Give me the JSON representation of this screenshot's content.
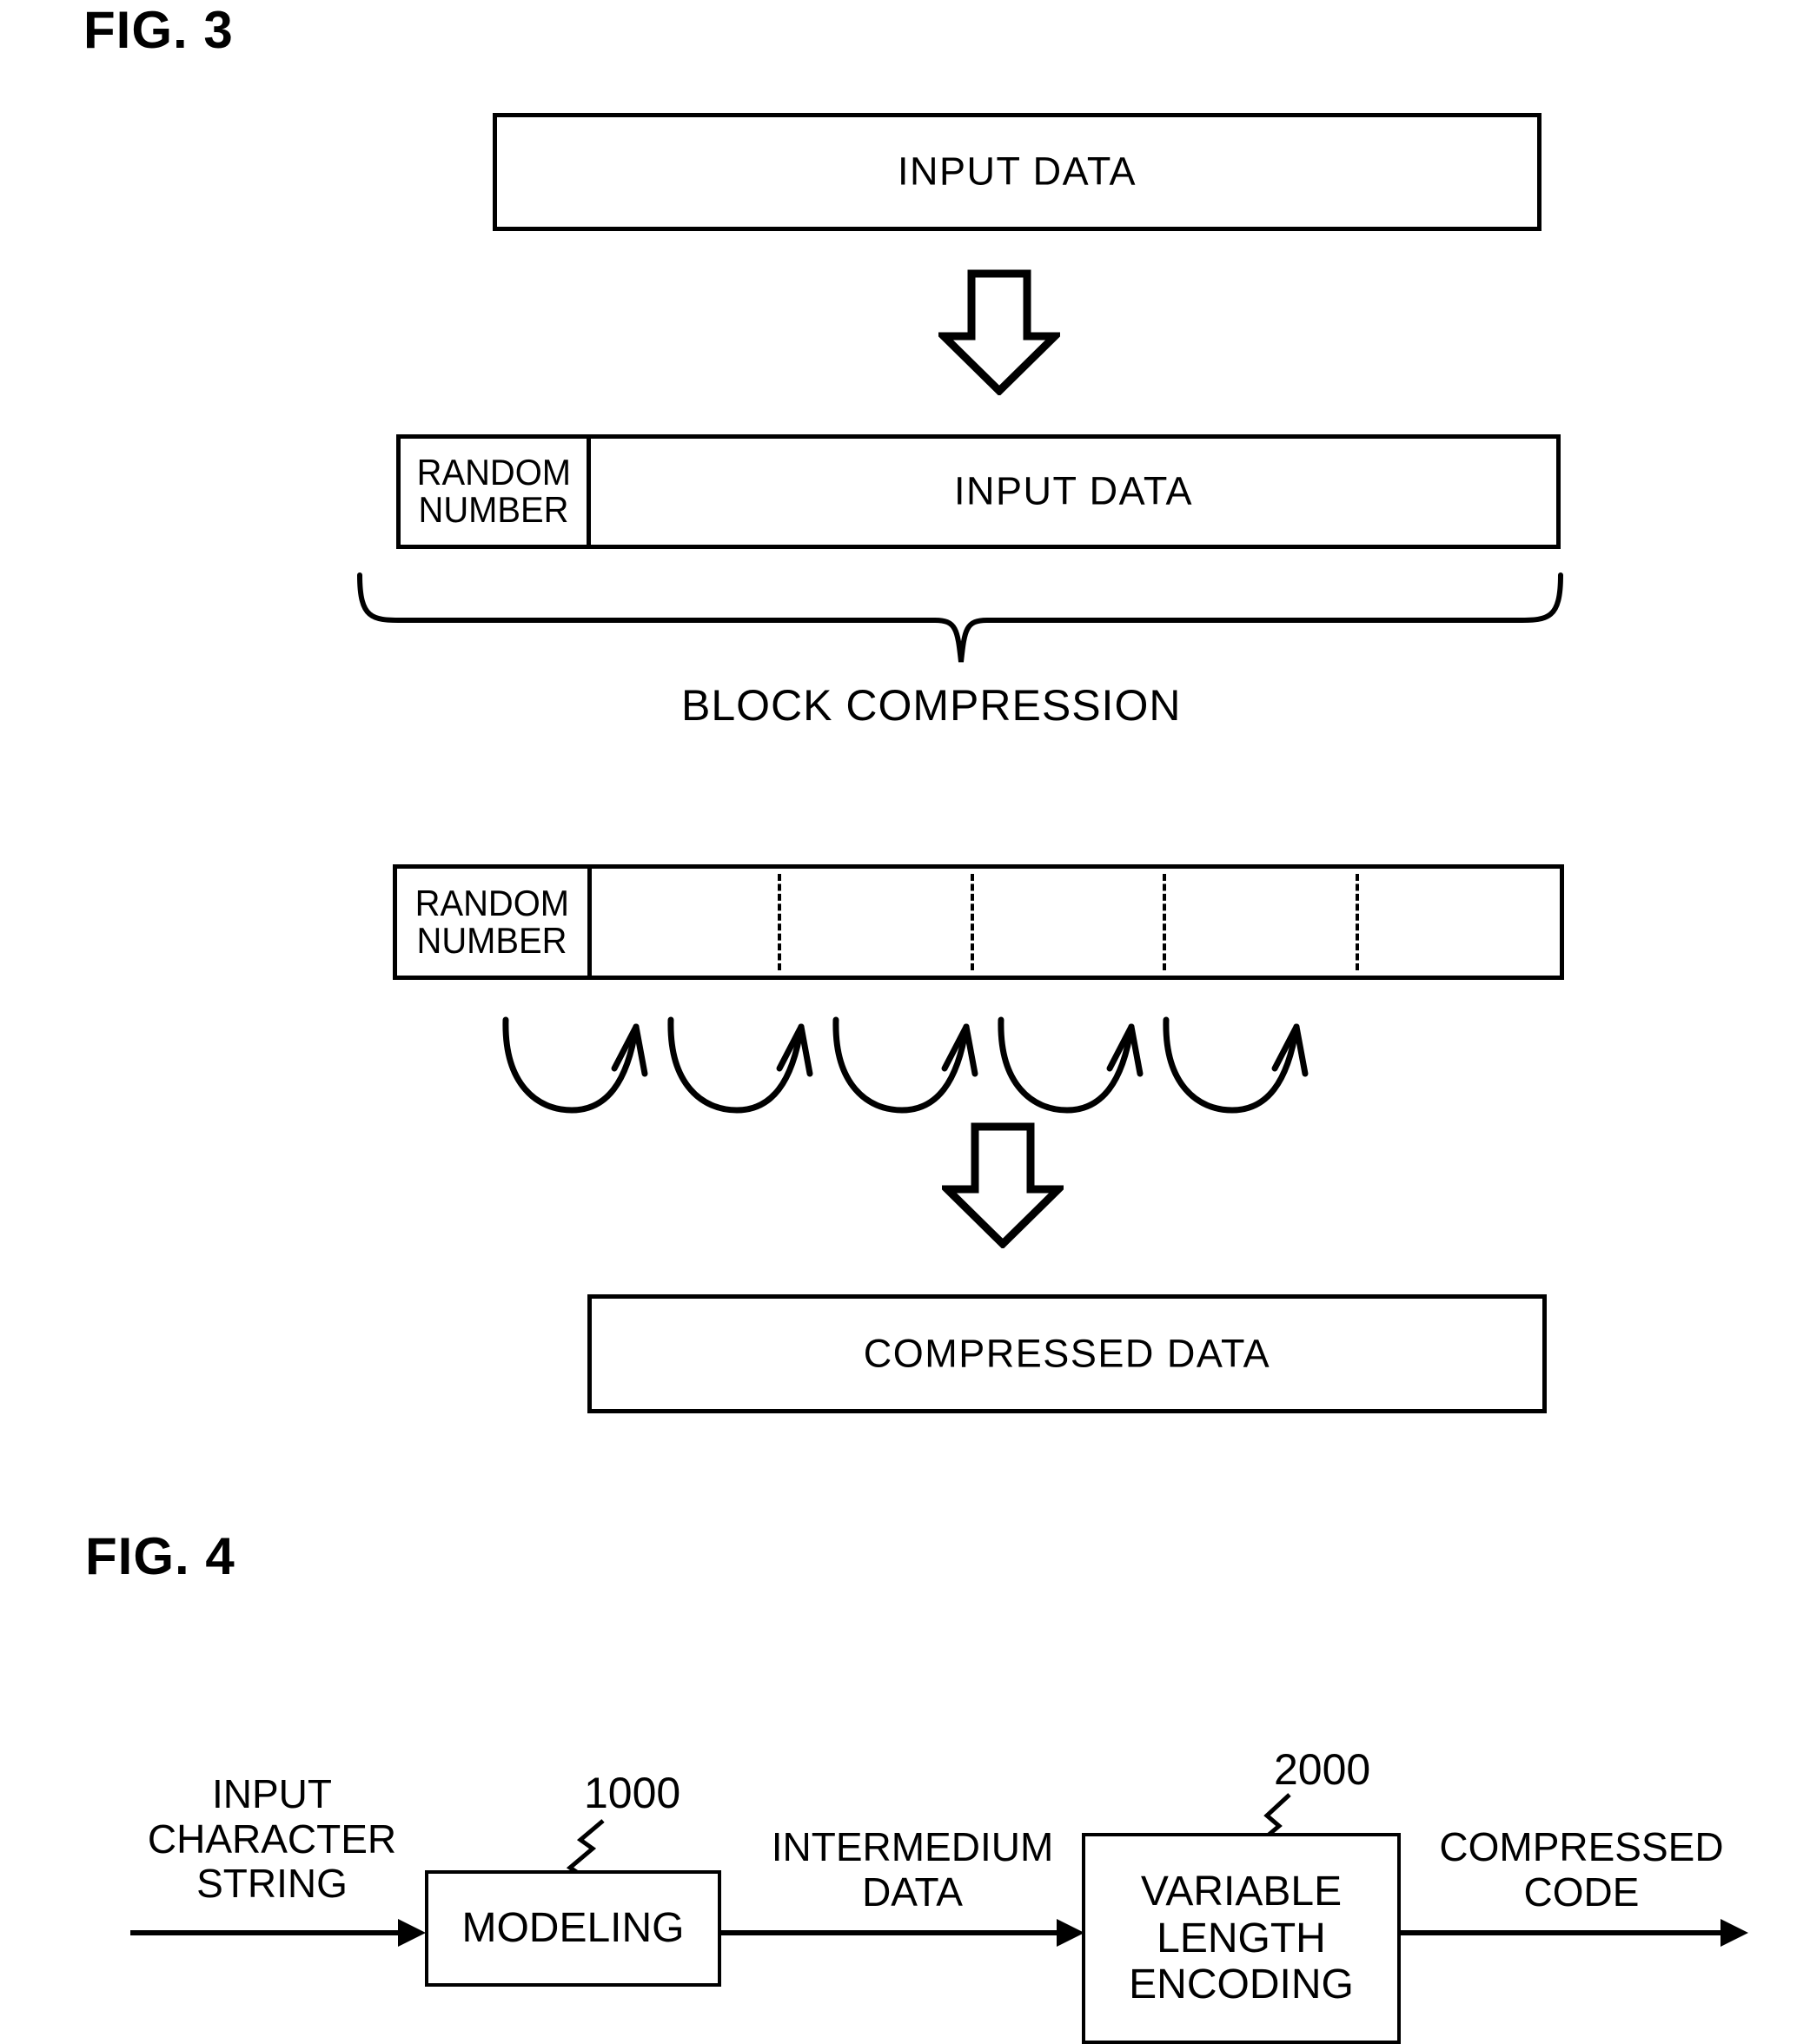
{
  "figures": [
    {
      "label": "FIG. 3",
      "boxes": {
        "input_data_top": "INPUT DATA",
        "random_number": "RANDOM\nNUMBER",
        "random_number_line1": "RANDOM",
        "random_number_line2": "NUMBER",
        "input_data_blocked": "INPUT DATA",
        "compressed_data": "COMPRESSED DATA"
      },
      "annotations": {
        "block_compression": "BLOCK  COMPRESSION"
      },
      "segment_count": 5,
      "curved_arrow_count": 5
    },
    {
      "label": "FIG. 4",
      "flow": {
        "input_label": "INPUT\nCHARACTER\nSTRING",
        "input_label_lines": [
          "INPUT",
          "CHARACTER",
          "STRING"
        ],
        "modeling_box": "MODELING",
        "modeling_ref": "1000",
        "intermediate_label_lines": [
          "INTERMEDIUM",
          "DATA"
        ],
        "vle_box_lines": [
          "VARIABLE",
          "LENGTH",
          "ENCODING"
        ],
        "vle_ref": "2000",
        "output_label_lines": [
          "COMPRESSED",
          "CODE"
        ]
      }
    }
  ],
  "colors": {
    "ink": "#000000",
    "paper": "#ffffff"
  }
}
